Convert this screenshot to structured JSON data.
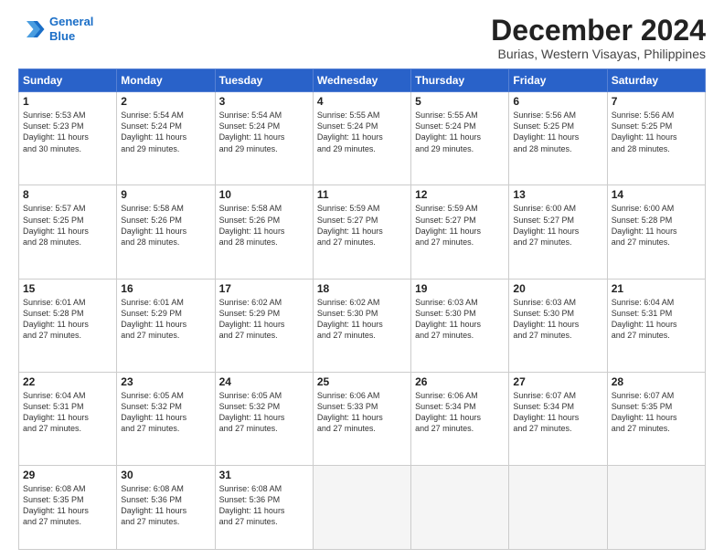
{
  "logo": {
    "line1": "General",
    "line2": "Blue"
  },
  "title": "December 2024",
  "subtitle": "Burias, Western Visayas, Philippines",
  "days_of_week": [
    "Sunday",
    "Monday",
    "Tuesday",
    "Wednesday",
    "Thursday",
    "Friday",
    "Saturday"
  ],
  "weeks": [
    [
      {
        "day": "1",
        "info": "Sunrise: 5:53 AM\nSunset: 5:23 PM\nDaylight: 11 hours\nand 30 minutes."
      },
      {
        "day": "2",
        "info": "Sunrise: 5:54 AM\nSunset: 5:24 PM\nDaylight: 11 hours\nand 29 minutes."
      },
      {
        "day": "3",
        "info": "Sunrise: 5:54 AM\nSunset: 5:24 PM\nDaylight: 11 hours\nand 29 minutes."
      },
      {
        "day": "4",
        "info": "Sunrise: 5:55 AM\nSunset: 5:24 PM\nDaylight: 11 hours\nand 29 minutes."
      },
      {
        "day": "5",
        "info": "Sunrise: 5:55 AM\nSunset: 5:24 PM\nDaylight: 11 hours\nand 29 minutes."
      },
      {
        "day": "6",
        "info": "Sunrise: 5:56 AM\nSunset: 5:25 PM\nDaylight: 11 hours\nand 28 minutes."
      },
      {
        "day": "7",
        "info": "Sunrise: 5:56 AM\nSunset: 5:25 PM\nDaylight: 11 hours\nand 28 minutes."
      }
    ],
    [
      {
        "day": "8",
        "info": "Sunrise: 5:57 AM\nSunset: 5:25 PM\nDaylight: 11 hours\nand 28 minutes."
      },
      {
        "day": "9",
        "info": "Sunrise: 5:58 AM\nSunset: 5:26 PM\nDaylight: 11 hours\nand 28 minutes."
      },
      {
        "day": "10",
        "info": "Sunrise: 5:58 AM\nSunset: 5:26 PM\nDaylight: 11 hours\nand 28 minutes."
      },
      {
        "day": "11",
        "info": "Sunrise: 5:59 AM\nSunset: 5:27 PM\nDaylight: 11 hours\nand 27 minutes."
      },
      {
        "day": "12",
        "info": "Sunrise: 5:59 AM\nSunset: 5:27 PM\nDaylight: 11 hours\nand 27 minutes."
      },
      {
        "day": "13",
        "info": "Sunrise: 6:00 AM\nSunset: 5:27 PM\nDaylight: 11 hours\nand 27 minutes."
      },
      {
        "day": "14",
        "info": "Sunrise: 6:00 AM\nSunset: 5:28 PM\nDaylight: 11 hours\nand 27 minutes."
      }
    ],
    [
      {
        "day": "15",
        "info": "Sunrise: 6:01 AM\nSunset: 5:28 PM\nDaylight: 11 hours\nand 27 minutes."
      },
      {
        "day": "16",
        "info": "Sunrise: 6:01 AM\nSunset: 5:29 PM\nDaylight: 11 hours\nand 27 minutes."
      },
      {
        "day": "17",
        "info": "Sunrise: 6:02 AM\nSunset: 5:29 PM\nDaylight: 11 hours\nand 27 minutes."
      },
      {
        "day": "18",
        "info": "Sunrise: 6:02 AM\nSunset: 5:30 PM\nDaylight: 11 hours\nand 27 minutes."
      },
      {
        "day": "19",
        "info": "Sunrise: 6:03 AM\nSunset: 5:30 PM\nDaylight: 11 hours\nand 27 minutes."
      },
      {
        "day": "20",
        "info": "Sunrise: 6:03 AM\nSunset: 5:30 PM\nDaylight: 11 hours\nand 27 minutes."
      },
      {
        "day": "21",
        "info": "Sunrise: 6:04 AM\nSunset: 5:31 PM\nDaylight: 11 hours\nand 27 minutes."
      }
    ],
    [
      {
        "day": "22",
        "info": "Sunrise: 6:04 AM\nSunset: 5:31 PM\nDaylight: 11 hours\nand 27 minutes."
      },
      {
        "day": "23",
        "info": "Sunrise: 6:05 AM\nSunset: 5:32 PM\nDaylight: 11 hours\nand 27 minutes."
      },
      {
        "day": "24",
        "info": "Sunrise: 6:05 AM\nSunset: 5:32 PM\nDaylight: 11 hours\nand 27 minutes."
      },
      {
        "day": "25",
        "info": "Sunrise: 6:06 AM\nSunset: 5:33 PM\nDaylight: 11 hours\nand 27 minutes."
      },
      {
        "day": "26",
        "info": "Sunrise: 6:06 AM\nSunset: 5:34 PM\nDaylight: 11 hours\nand 27 minutes."
      },
      {
        "day": "27",
        "info": "Sunrise: 6:07 AM\nSunset: 5:34 PM\nDaylight: 11 hours\nand 27 minutes."
      },
      {
        "day": "28",
        "info": "Sunrise: 6:07 AM\nSunset: 5:35 PM\nDaylight: 11 hours\nand 27 minutes."
      }
    ],
    [
      {
        "day": "29",
        "info": "Sunrise: 6:08 AM\nSunset: 5:35 PM\nDaylight: 11 hours\nand 27 minutes."
      },
      {
        "day": "30",
        "info": "Sunrise: 6:08 AM\nSunset: 5:36 PM\nDaylight: 11 hours\nand 27 minutes."
      },
      {
        "day": "31",
        "info": "Sunrise: 6:08 AM\nSunset: 5:36 PM\nDaylight: 11 hours\nand 27 minutes."
      },
      {
        "day": "",
        "info": ""
      },
      {
        "day": "",
        "info": ""
      },
      {
        "day": "",
        "info": ""
      },
      {
        "day": "",
        "info": ""
      }
    ]
  ]
}
